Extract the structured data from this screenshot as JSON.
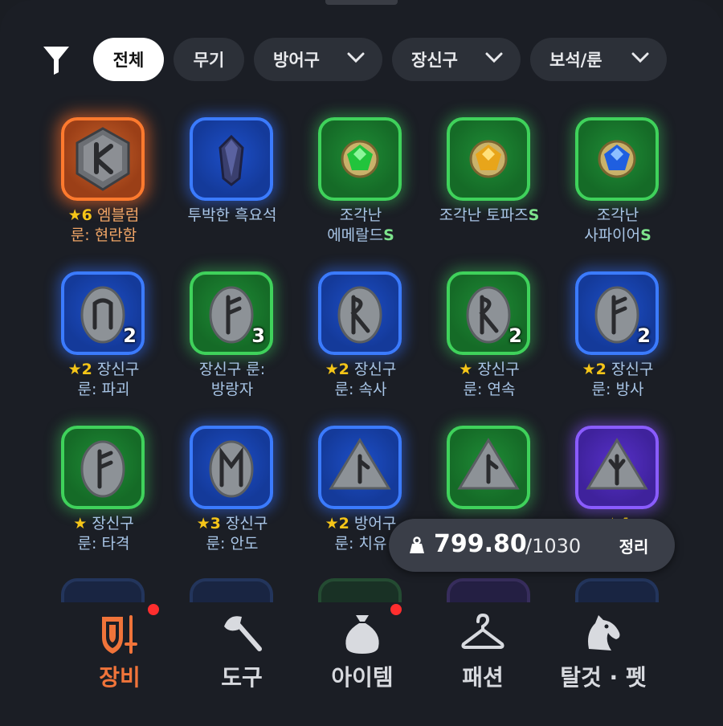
{
  "filter": {
    "chips": [
      {
        "label": "전체",
        "active": true
      },
      {
        "label": "무기",
        "active": false
      },
      {
        "label": "방어구",
        "active": false,
        "dropdown": true
      },
      {
        "label": "장신구",
        "active": false,
        "dropdown": true
      },
      {
        "label": "보석/룬",
        "active": false,
        "dropdown": true
      }
    ]
  },
  "items": [
    {
      "grade": "orange",
      "icon": "emblem-rune-icon",
      "star": "★6",
      "line1": "엠블럼",
      "line2": "룬: 현란함"
    },
    {
      "grade": "blue",
      "icon": "obsidian-gem-icon",
      "line1": "투박한 흑요석",
      "line2": ""
    },
    {
      "grade": "green",
      "icon": "emerald-gem-icon",
      "line1": "조각난",
      "line2": "에메랄드",
      "s_mark": "S"
    },
    {
      "grade": "green",
      "icon": "topaz-gem-icon",
      "line1": "조각난 토파즈",
      "line1_s": "S",
      "line2": ""
    },
    {
      "grade": "green",
      "icon": "sapphire-gem-icon",
      "line1": "조각난",
      "line2": "사파이어",
      "s_mark": "S"
    },
    {
      "grade": "blue",
      "icon": "rune-stone-icon",
      "count": "2",
      "star": "★2",
      "line1": "장신구",
      "line2": "룬: 파괴"
    },
    {
      "grade": "green",
      "icon": "rune-stone-icon",
      "count": "3",
      "line1": "장신구 룬:",
      "line2": "방랑자"
    },
    {
      "grade": "blue",
      "icon": "rune-stone-icon",
      "star": "★2",
      "line1": "장신구",
      "line2": "룬: 속사"
    },
    {
      "grade": "green",
      "icon": "rune-stone-icon",
      "count": "2",
      "star": "★",
      "line1": "장신구",
      "line2": "룬: 연속"
    },
    {
      "grade": "blue",
      "icon": "rune-stone-icon",
      "count": "2",
      "star": "★2",
      "line1": "장신구",
      "line2": "룬: 방사"
    },
    {
      "grade": "green",
      "icon": "rune-stone-icon",
      "star": "★",
      "line1": "장신구",
      "line2": "룬: 타격"
    },
    {
      "grade": "blue",
      "icon": "rune-stone-icon",
      "star": "★3",
      "line1": "장신구",
      "line2": "룬: 안도"
    },
    {
      "grade": "blue",
      "icon": "triangle-rune-icon",
      "star": "★2",
      "line1": "방어구",
      "line2": "룬: 치유"
    },
    {
      "grade": "green",
      "icon": "triangle-rune-icon",
      "line1": "",
      "line2": ""
    },
    {
      "grade": "purple",
      "icon": "triangle-rune-icon",
      "star": "★4",
      "line1": "",
      "line2": ""
    }
  ],
  "weight": {
    "current": "799.80",
    "max": "/1030",
    "sort_label": "정리"
  },
  "nav": [
    {
      "label": "장비",
      "icon": "shield-sword-icon",
      "active": true,
      "badge": true
    },
    {
      "label": "도구",
      "icon": "axe-icon",
      "active": false,
      "badge": false
    },
    {
      "label": "아이템",
      "icon": "bag-icon",
      "active": false,
      "badge": true
    },
    {
      "label": "패션",
      "icon": "hanger-icon",
      "active": false,
      "badge": false
    },
    {
      "label": "탈것 · 펫",
      "icon": "horse-icon",
      "active": false,
      "badge": false
    }
  ],
  "colors": {
    "accent": "#f0743a",
    "badge": "#ff2e2e",
    "star": "#f5c518"
  }
}
